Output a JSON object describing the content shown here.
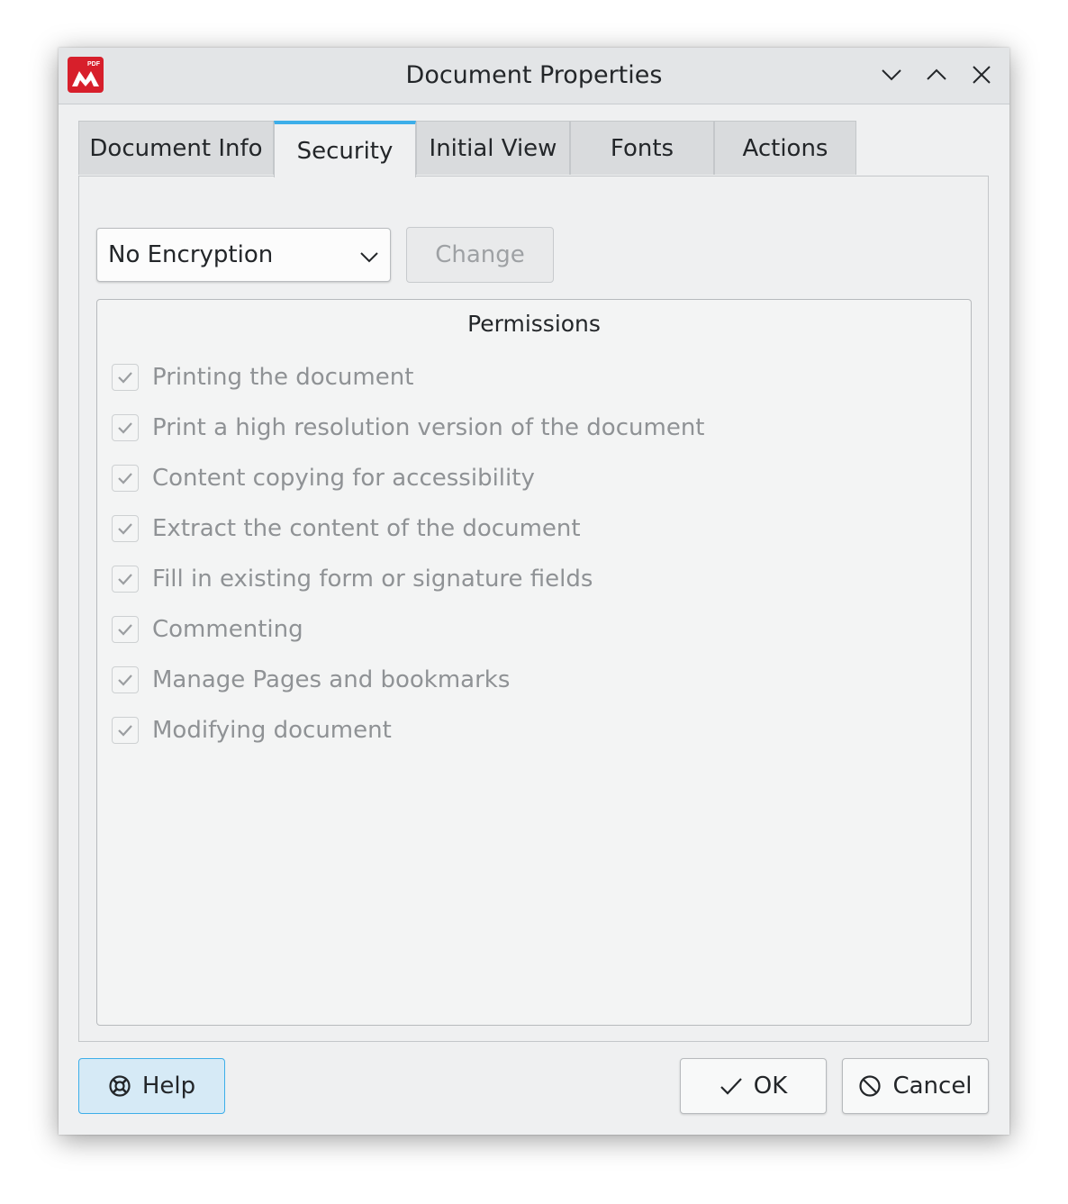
{
  "window": {
    "title": "Document Properties",
    "app_icon_text": "PDF",
    "controls": [
      "chevron-down-icon",
      "chevron-up-icon",
      "close-icon"
    ]
  },
  "tabs": [
    {
      "label": "Document Info",
      "active": false
    },
    {
      "label": "Security",
      "active": true
    },
    {
      "label": "Initial View",
      "active": false
    },
    {
      "label": "Fonts",
      "active": false
    },
    {
      "label": "Actions",
      "active": false
    }
  ],
  "security": {
    "encryption_value": "No Encryption",
    "change_label": "Change",
    "permissions_title": "Permissions",
    "permissions": [
      {
        "label": "Printing the document",
        "checked": true
      },
      {
        "label": "Print a high resolution version of the document",
        "checked": true
      },
      {
        "label": "Content copying for accessibility",
        "checked": true
      },
      {
        "label": "Extract the content of the document",
        "checked": true
      },
      {
        "label": "Fill in existing form or signature fields",
        "checked": true
      },
      {
        "label": "Commenting",
        "checked": true
      },
      {
        "label": "Manage Pages and bookmarks",
        "checked": true
      },
      {
        "label": "Modifying document",
        "checked": true
      }
    ]
  },
  "footer": {
    "help_label": "Help",
    "ok_label": "OK",
    "cancel_label": "Cancel"
  },
  "colors": {
    "accent": "#3daee9",
    "app_icon": "#d71f2b",
    "disabled_text": "#8f9295"
  }
}
